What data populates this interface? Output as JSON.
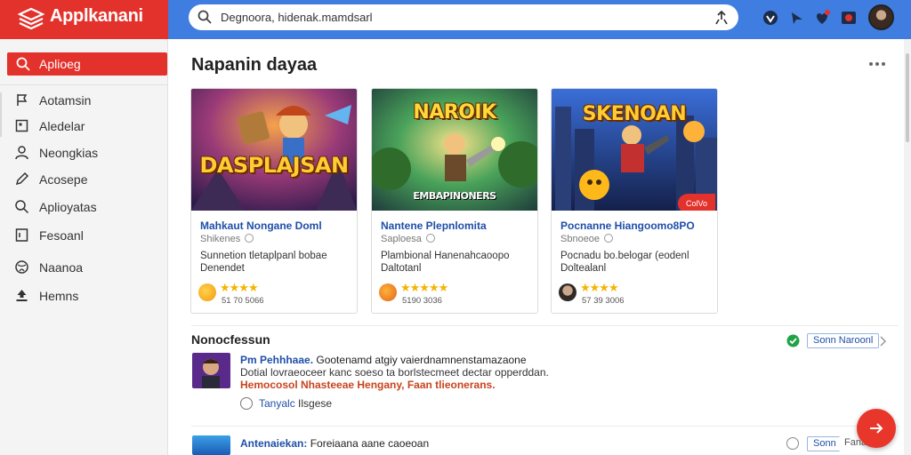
{
  "app": {
    "brand_name": "Applkanani",
    "brand_tagline": "",
    "accent": "#e3322c",
    "topbar_color": "#3f7de0"
  },
  "search": {
    "value": "Degnoora, hidenak.mamdsarl",
    "placeholder": ""
  },
  "header_icons": [
    "shield-icon",
    "bolt-icon",
    "heart-notification-icon",
    "record-icon"
  ],
  "sidebar": {
    "active": {
      "label": "Aplioeg",
      "icon": "search-icon"
    },
    "items": [
      {
        "label": "Aotamsin",
        "icon": "flag-icon"
      },
      {
        "label": "Aledelar",
        "icon": "square-icon"
      },
      {
        "label": "Neongkias",
        "icon": "user-icon"
      },
      {
        "label": "Acosepe",
        "icon": "pencil-icon"
      },
      {
        "label": "Aplioyatas",
        "icon": "search-icon"
      },
      {
        "label": "Fesoanl",
        "icon": "document-icon"
      },
      {
        "label": "Naanoa",
        "icon": "globe-icon"
      },
      {
        "label": "Hemns",
        "icon": "upload-icon"
      }
    ]
  },
  "main": {
    "title": "Napanin dayaa",
    "cards": [
      {
        "art_text": "DASPLAJSAN",
        "title": "Mahkaut Nongane Doml",
        "subtitle": "Shikenes",
        "description": "Sunnetion tletaplpanl bobae Denendet",
        "stars": "★★★★",
        "count": "51 70 5066",
        "emoji": "smile"
      },
      {
        "art_text": "NAROIK",
        "art_sub": "EMBAPINONERS",
        "title": "Nantene Plepnlomita",
        "subtitle": "Saploesa",
        "description": "Plambional Hanenahcaoopo Daltotanl",
        "stars": "★★★★★",
        "count": "5190 3036",
        "emoji": "smile"
      },
      {
        "art_text": "SKENOAN",
        "badge": "ColVo",
        "title": "Pocnanne Hiangoomo8PO",
        "subtitle": "Sbnoeoe",
        "description": "Pocnadu bo.belogar (eodenl Doltealanl",
        "stars": "★★★★",
        "count": "57 39 3006",
        "emoji": "avatar"
      }
    ],
    "section": {
      "title": "Nonocfessun",
      "button": "Sonn Naroonl",
      "items": [
        {
          "title_bold": "Pm Pehhhaae.",
          "title_rest": "Gootenamd atgiy vaierdnamnenstamazaone",
          "line2": "Dotial lovraeoceer kanc soeso ta borlstecmeet dectar opperddan.",
          "line3": "Hemocosol Nhasteeae Hengany, Faan tlieonerans.",
          "radio_label": "Tanyalc",
          "radio_rest": "Ilsgese"
        },
        {
          "title_bold": "Antenaiekan:",
          "title_rest": "Foreiaana aane caoeoan",
          "button": "Sonn",
          "button2": "Fana"
        }
      ]
    }
  }
}
